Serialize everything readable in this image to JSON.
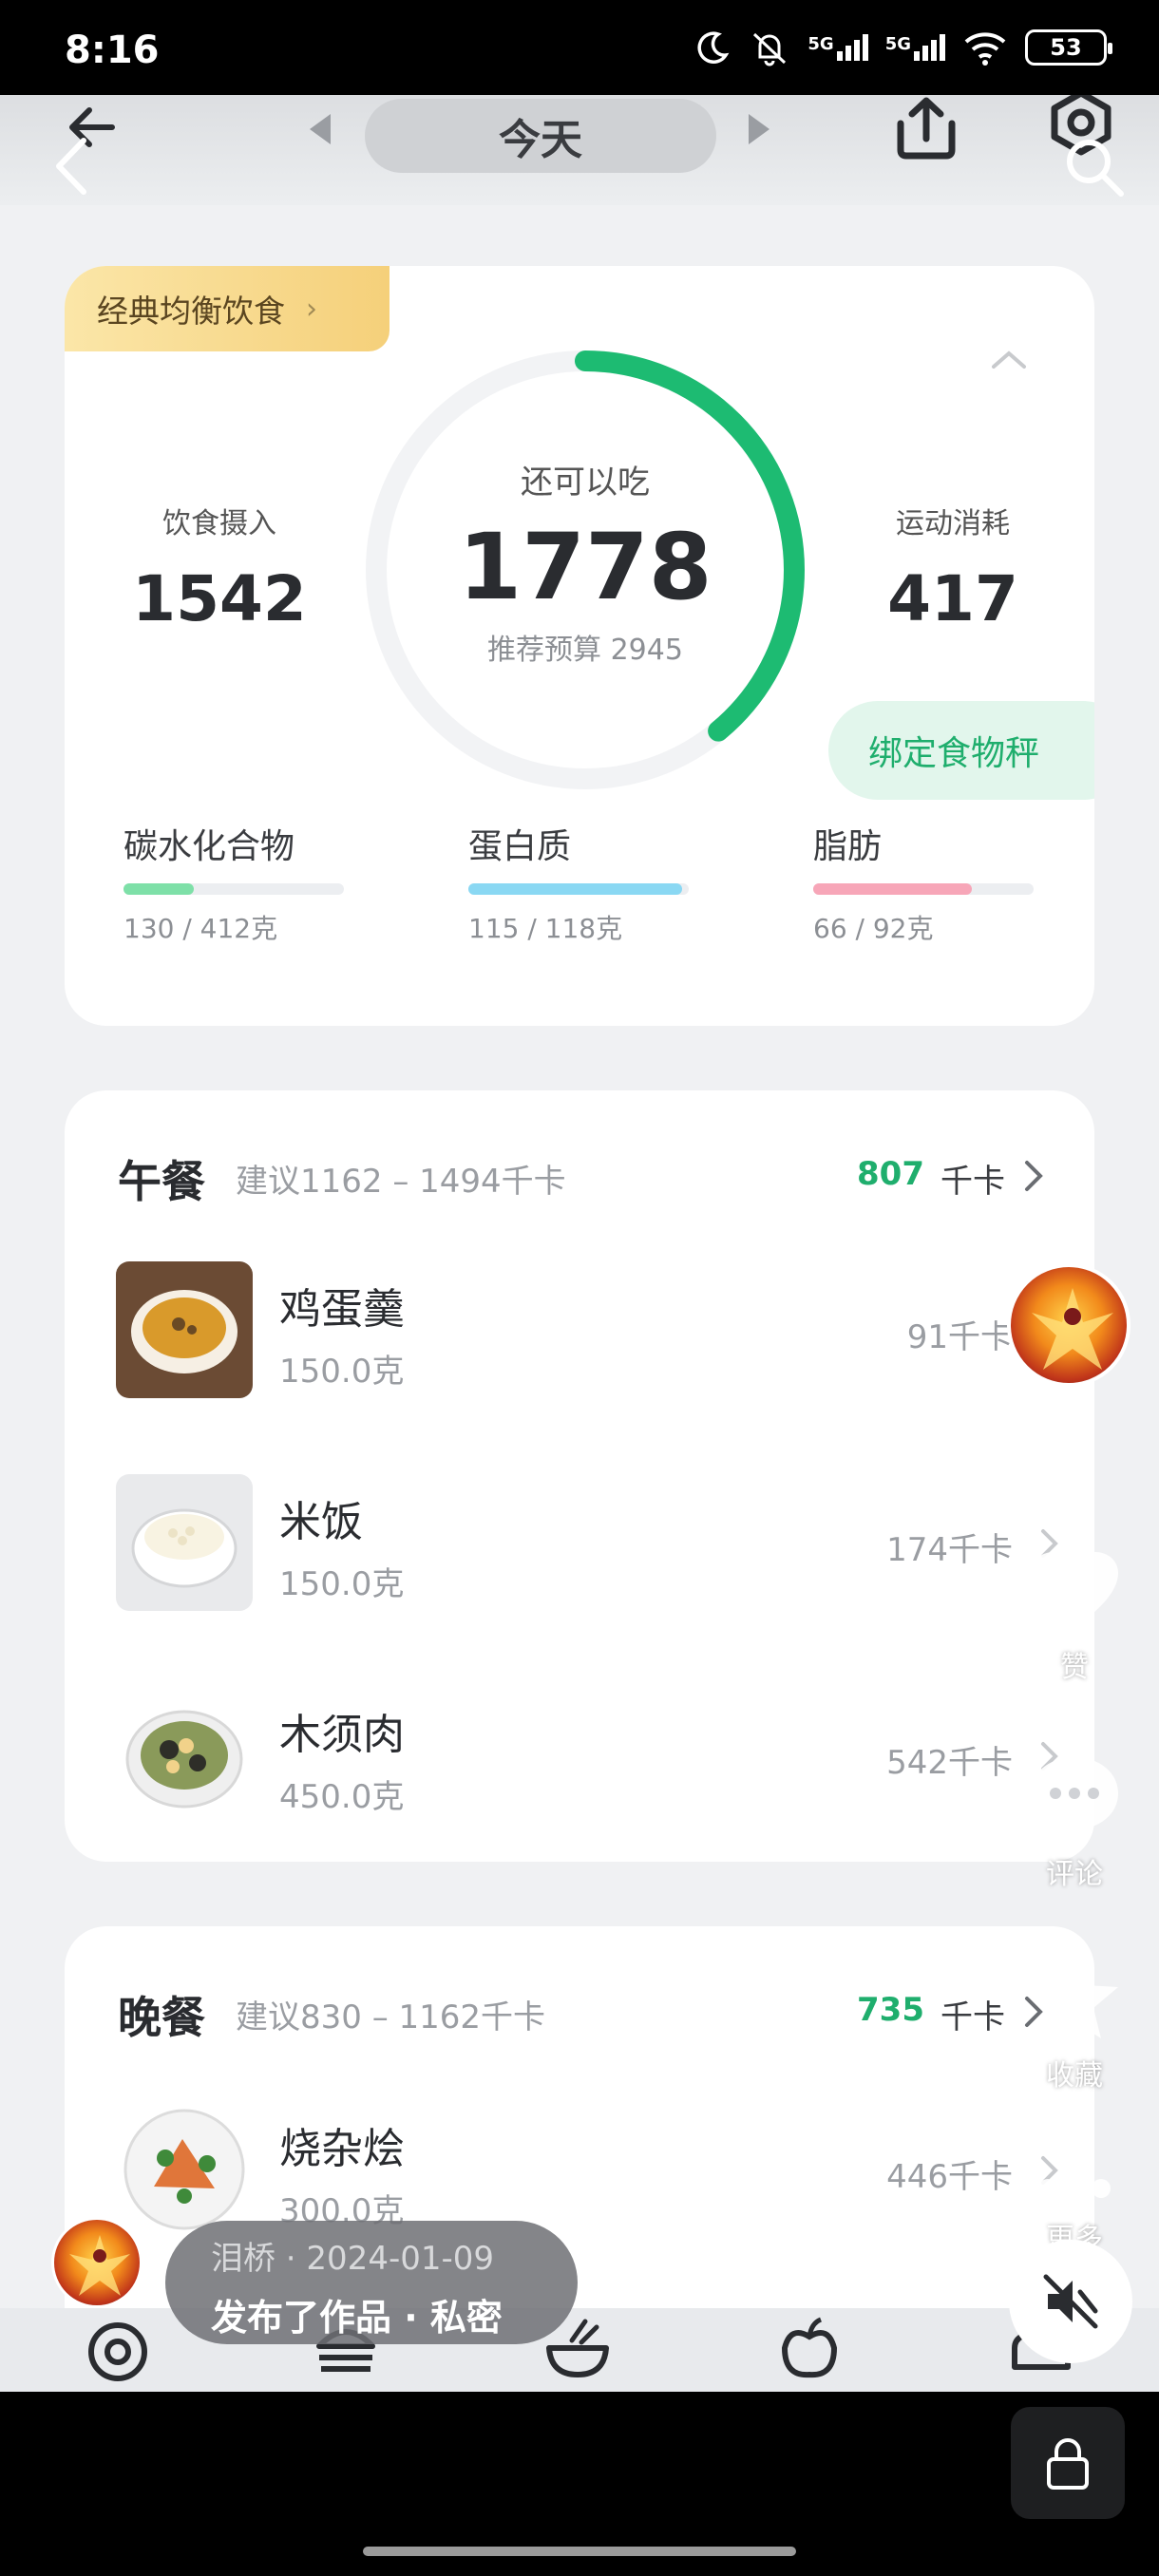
{
  "status_bar": {
    "time": "8:16",
    "battery": "53",
    "network_1": "5G",
    "network_2": "5G"
  },
  "header": {
    "date_label": "今天"
  },
  "summary": {
    "plan_tag": "经典均衡饮食",
    "intake_label": "饮食摄入",
    "intake_value": "1542",
    "remaining_label": "还可以吃",
    "remaining_value": "1778",
    "budget_text": "推荐预算 2945",
    "exercise_label": "运动消耗",
    "exercise_value": "417",
    "bind_scale_label": "绑定食物秤",
    "ring_progress": 0.39,
    "macros": [
      {
        "name": "碳水化合物",
        "value": "130 / 412克",
        "fraction": 0.32,
        "color": "#7ee0a8"
      },
      {
        "name": "蛋白质",
        "value": "115 / 118克",
        "fraction": 0.97,
        "color": "#8ad8f3"
      },
      {
        "name": "脂肪",
        "value": "66 / 92克",
        "fraction": 0.72,
        "color": "#f7a6b8"
      }
    ]
  },
  "lunch": {
    "title": "午餐",
    "suggest": "建议1162 – 1494千卡",
    "kcal": "807",
    "unit": "千卡",
    "items": [
      {
        "name": "鸡蛋羹",
        "weight": "150.0克",
        "kcal": "91千卡"
      },
      {
        "name": "米饭",
        "weight": "150.0克",
        "kcal": "174千卡"
      },
      {
        "name": "木须肉",
        "weight": "450.0克",
        "kcal": "542千卡"
      }
    ]
  },
  "dinner": {
    "title": "晚餐",
    "suggest": "建议830 – 1162千卡",
    "kcal": "735",
    "unit": "千卡",
    "items": [
      {
        "name": "烧杂烩",
        "weight": "300.0克",
        "kcal": "446千卡"
      }
    ]
  },
  "side_actions": {
    "like": "赞",
    "comment": "评论",
    "favorite": "收藏",
    "more": "更多"
  },
  "publish": {
    "line1": "泪桥 · 2024-01-09",
    "line2": "发布了作品 · 私密"
  }
}
